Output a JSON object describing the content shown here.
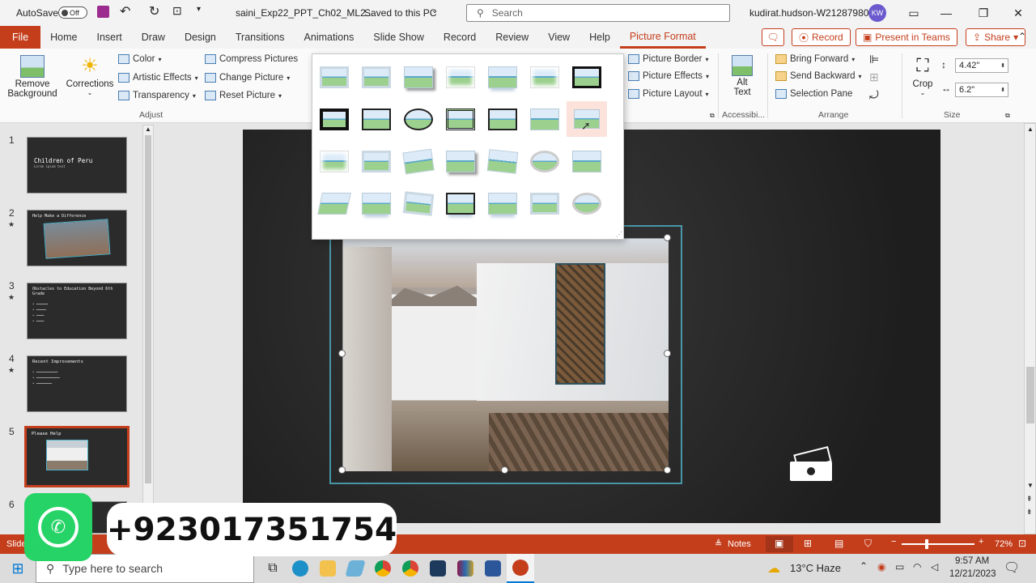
{
  "titlebar": {
    "autosave_label": "AutoSave",
    "autosave_state": "Off",
    "doc_title": "saini_Exp22_PPT_Ch02_ML2...",
    "save_status": "Saved to this PC",
    "search_placeholder": "Search",
    "user": "kudirat.hudson-W212879806",
    "avatar_initials": "KW"
  },
  "tabs": [
    "File",
    "Home",
    "Insert",
    "Draw",
    "Design",
    "Transitions",
    "Animations",
    "Slide Show",
    "Record",
    "Review",
    "View",
    "Help",
    "Picture Format"
  ],
  "tab_buttons": {
    "record": "Record",
    "present_teams": "Present in Teams",
    "share": "Share"
  },
  "ribbon": {
    "remove_background": "Remove\nBackground",
    "corrections": "Corrections",
    "color": "Color",
    "artistic_effects": "Artistic Effects",
    "transparency": "Transparency",
    "compress_pictures": "Compress Pictures",
    "change_picture": "Change Picture",
    "reset_picture": "Reset Picture",
    "adjust_group": "Adjust",
    "picture_border": "Picture Border",
    "picture_effects": "Picture Effects",
    "picture_layout": "Picture Layout",
    "alt_text": "Alt\nText",
    "accessibility_group": "Accessibi...",
    "bring_forward": "Bring Forward",
    "send_backward": "Send Backward",
    "selection_pane": "Selection Pane",
    "arrange_group": "Arrange",
    "crop": "Crop",
    "height_value": "4.42\"",
    "width_value": "6.2\"",
    "size_group": "Size"
  },
  "slides": [
    {
      "num": "1",
      "title": "Children of Peru",
      "sub": "Lorem ipsum text",
      "star": false
    },
    {
      "num": "2",
      "title": "Help Make a Difference",
      "sub": "",
      "star": true
    },
    {
      "num": "3",
      "title": "Obstacles to Education Beyond 6th Grade",
      "sub": "",
      "star": true
    },
    {
      "num": "4",
      "title": "Recent Improvements",
      "sub": "",
      "star": true
    },
    {
      "num": "5",
      "title": "Please Help",
      "sub": "",
      "star": false
    },
    {
      "num": "6",
      "title": "",
      "sub": "",
      "star": false
    }
  ],
  "status": {
    "slide_label": "Slide",
    "notes": "Notes",
    "zoom": "72%"
  },
  "taskbar": {
    "search_placeholder": "Type here to search",
    "weather": "13°C  Haze",
    "time": "9:57 AM",
    "date": "12/21/2023"
  },
  "overlay": {
    "phone": "+923017351754"
  }
}
